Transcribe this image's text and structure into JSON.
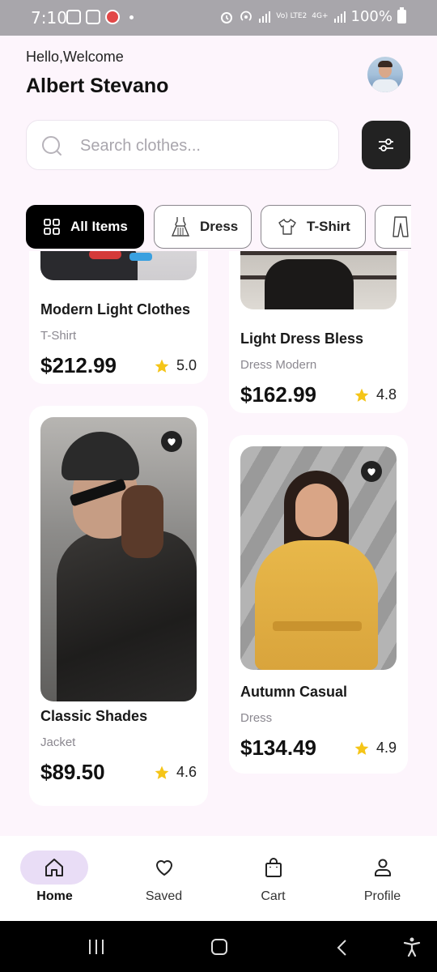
{
  "status_bar": {
    "time": "7:10",
    "network_label": "Vo) LTE2",
    "network_gen": "4G+",
    "battery": "100%"
  },
  "header": {
    "greeting": "Hello,Welcome",
    "user_name": "Albert Stevano"
  },
  "search": {
    "placeholder": "Search clothes..."
  },
  "categories": [
    {
      "label": "All Items",
      "icon": "grid-icon",
      "active": true
    },
    {
      "label": "Dress",
      "icon": "dress-icon",
      "active": false
    },
    {
      "label": "T-Shirt",
      "icon": "tshirt-icon",
      "active": false
    },
    {
      "label": "",
      "icon": "pants-icon",
      "active": false
    }
  ],
  "products": [
    {
      "title": "Modern Light Clothes",
      "category": "T-Shirt",
      "price": "$212.99",
      "rating": "5.0"
    },
    {
      "title": "Light Dress Bless",
      "category": "Dress Modern",
      "price": "$162.99",
      "rating": "4.8"
    },
    {
      "title": "Classic Shades",
      "category": "Jacket",
      "price": "$89.50",
      "rating": "4.6"
    },
    {
      "title": "Autumn Casual",
      "category": "Dress",
      "price": "$134.49",
      "rating": "4.9"
    }
  ],
  "bottom_nav": [
    {
      "label": "Home",
      "icon": "home-icon",
      "active": true
    },
    {
      "label": "Saved",
      "icon": "heart-outline-icon",
      "active": false
    },
    {
      "label": "Cart",
      "icon": "shopping-bag-icon",
      "active": false
    },
    {
      "label": "Profile",
      "icon": "person-icon",
      "active": false
    }
  ],
  "colors": {
    "background": "#fdf5fc",
    "accent_dark": "#000000",
    "star": "#f5c518",
    "nav_active_pill": "#e9ddf6"
  }
}
